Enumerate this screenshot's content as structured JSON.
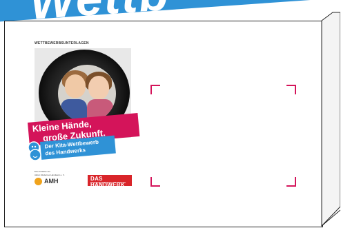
{
  "banner": {
    "text": "Wettb",
    "color": "#2f92d6"
  },
  "document": {
    "header_label": "WETTBEWERBSUNTERLAGEN",
    "headline_line1": "Kleine Hände,",
    "headline_line2": "große Zukunft.",
    "subline_line1": "Der Kita-Wettbewerb",
    "subline_line2": "des Handwerks",
    "small_line1": "Eine Initiative der",
    "small_line2": "Aktion Modernes Handwerk e. V.",
    "amh_logo": "AMH",
    "handwerk_title": "DAS HANDWERK",
    "handwerk_sub": "DIE WIRTSCHAFTSMACHT. VON NEBENAN."
  },
  "colors": {
    "pink": "#d4145a",
    "blue": "#2f92d6",
    "red": "#d9252a",
    "amh_orange": "#f0a31c"
  }
}
